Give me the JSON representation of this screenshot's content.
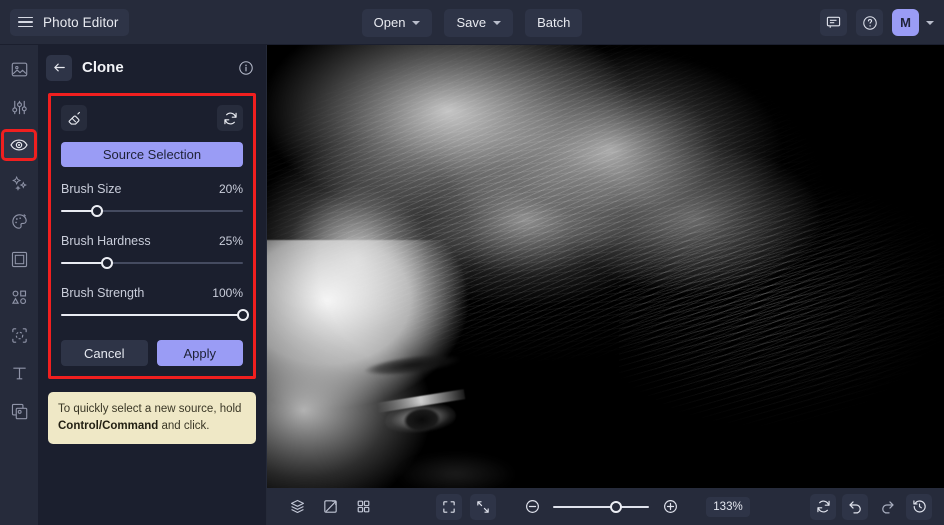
{
  "app": {
    "name": "Photo Editor",
    "accent": "#9a9cf5",
    "highlight_color": "#f01f1f",
    "topbar_bg": "#262b3b",
    "panel_bg": "#1b1f2e",
    "hint_bg": "#efe8c6"
  },
  "topbar": {
    "menu_icon": "hamburger-icon",
    "brand_label": "Photo Editor",
    "center_buttons": [
      {
        "label": "Open",
        "has_caret": true,
        "name": "open-button"
      },
      {
        "label": "Save",
        "has_caret": true,
        "name": "save-button"
      },
      {
        "label": "Batch",
        "has_caret": false,
        "name": "batch-button"
      }
    ],
    "right": {
      "feedback_icon": "comment-icon",
      "help_icon": "question-circle-icon",
      "avatar_initial": "M",
      "avatar_caret_icon": "chevron-down-icon"
    }
  },
  "left_rail": {
    "items": [
      {
        "label": "Image",
        "icon": "image-icon",
        "selected": false
      },
      {
        "label": "Adjust",
        "icon": "sliders-icon",
        "selected": false
      },
      {
        "label": "Retouch",
        "icon": "eye-icon",
        "selected": true
      },
      {
        "label": "Effects",
        "icon": "sparkles-icon",
        "selected": false
      },
      {
        "label": "Color",
        "icon": "palette-icon",
        "selected": false
      },
      {
        "label": "Frame",
        "icon": "frame-icon",
        "selected": false
      },
      {
        "label": "Shapes",
        "icon": "shapes-icon",
        "selected": false
      },
      {
        "label": "Cutout",
        "icon": "cutout-icon",
        "selected": false
      },
      {
        "label": "Text",
        "icon": "text-icon",
        "selected": false
      },
      {
        "label": "Overlay",
        "icon": "overlay-icon",
        "selected": false
      }
    ]
  },
  "panel": {
    "back_icon": "arrow-left-icon",
    "title": "Clone",
    "info_icon": "info-circle-icon",
    "tools": {
      "erase_icon": "eraser-icon",
      "reset_icon": "refresh-icon"
    },
    "source_selection_label": "Source Selection",
    "sliders": [
      {
        "label": "Brush Size",
        "value_text": "20%",
        "value": 20,
        "name": "brush-size-slider"
      },
      {
        "label": "Brush Hardness",
        "value_text": "25%",
        "value": 25,
        "name": "brush-hardness-slider"
      },
      {
        "label": "Brush Strength",
        "value_text": "100%",
        "value": 100,
        "name": "brush-strength-slider"
      }
    ],
    "cancel_label": "Cancel",
    "apply_label": "Apply",
    "hint": {
      "text_before": "To quickly select a new source, hold ",
      "text_bold": "Control/Command",
      "text_after": " and click."
    }
  },
  "canvas": {
    "description": "Black and white close-up portrait of a woman with windswept blonde hair",
    "clone_source_marker_icon": "clone-source-crosshair-icon",
    "brush_cursor_icon": "brush-crosshair-icon"
  },
  "bottombar": {
    "left_buttons": [
      {
        "icon": "layers-icon",
        "name": "layers-button"
      },
      {
        "icon": "compare-icon",
        "name": "compare-button"
      },
      {
        "icon": "grid-icon",
        "name": "grid-button"
      }
    ],
    "center": {
      "fit_icon": "fit-screen-icon",
      "collapse_icon": "collapse-icon",
      "zoom_out_icon": "zoom-out-icon",
      "zoom_in_icon": "zoom-in-icon",
      "zoom_value": "133%",
      "zoom_slider_pct": 66
    },
    "right_buttons": [
      {
        "icon": "reset-view-icon",
        "name": "reset-view-button"
      },
      {
        "icon": "undo-icon",
        "name": "undo-button"
      },
      {
        "icon": "redo-icon",
        "name": "redo-button"
      },
      {
        "icon": "history-icon",
        "name": "history-button"
      }
    ]
  }
}
